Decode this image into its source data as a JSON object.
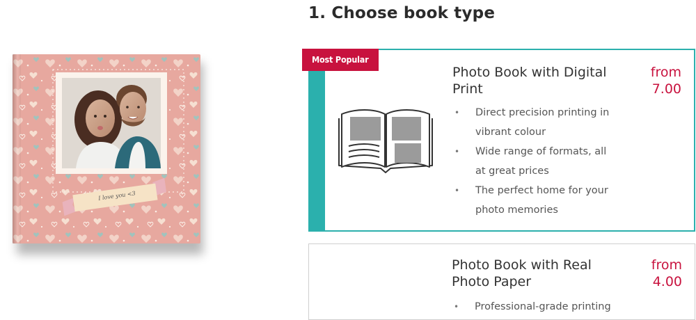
{
  "cover": {
    "banner_text": "I love you <3"
  },
  "section_title": "1. Choose book type",
  "cards": [
    {
      "badge": "Most Popular",
      "title": "Photo Book with Digital Print",
      "price_prefix": "from",
      "price": "7.00",
      "features": [
        "Direct precision printing in vibrant colour",
        "Wide range of formats, all at great prices",
        "The perfect home for your photo memories"
      ],
      "selected": true,
      "accent_color": "#2bb0ad"
    },
    {
      "title": "Photo Book with Real Photo Paper",
      "price_prefix": "from",
      "price": "4.00",
      "features": [
        "Professional-grade printing"
      ],
      "selected": false
    }
  ],
  "colors": {
    "accent": "#2bb0ad",
    "brand": "#c8123e",
    "cover_pink": "#e7a89f"
  }
}
